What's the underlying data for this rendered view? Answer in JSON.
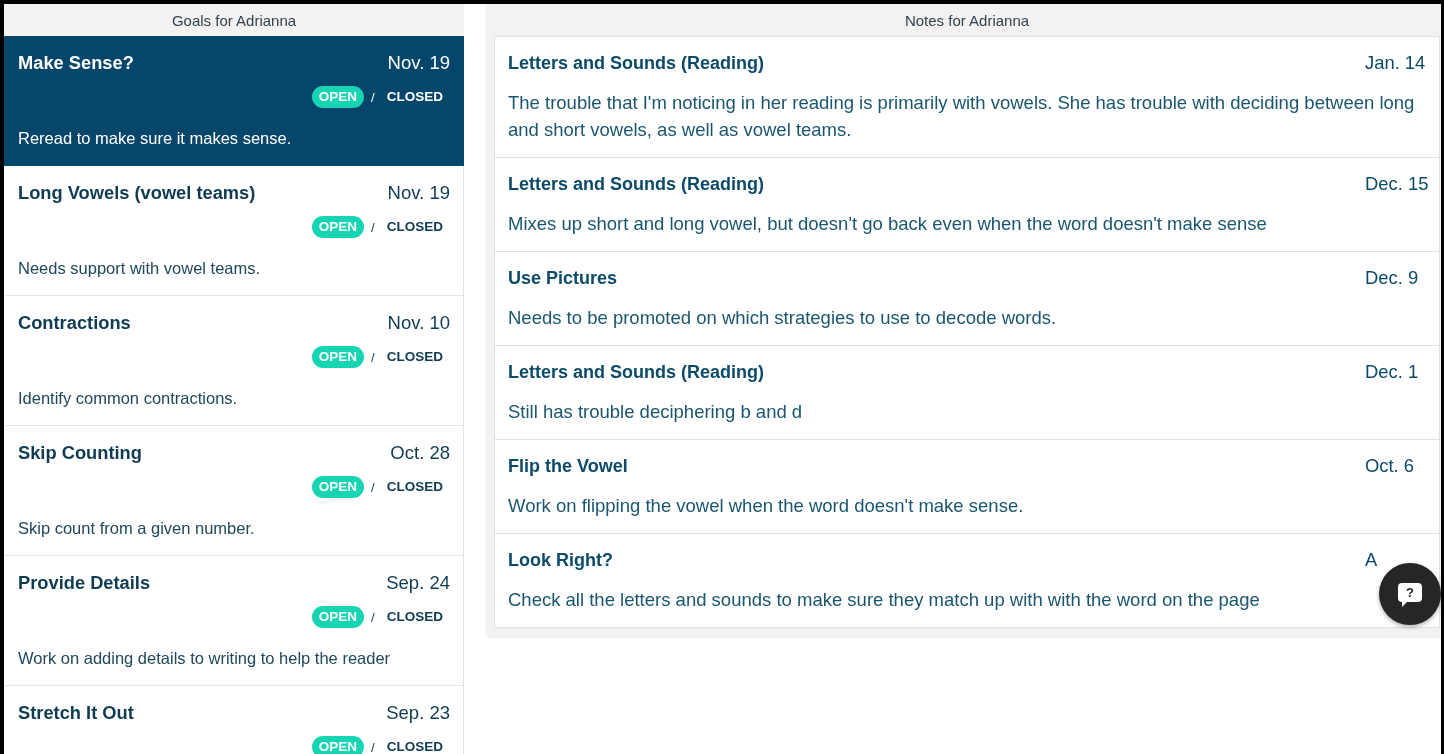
{
  "goals_panel": {
    "title": "Goals for Adrianna",
    "goals": [
      {
        "title": "Make Sense?",
        "date": "Nov. 19",
        "open_label": "OPEN",
        "separator": "/",
        "closed_label": "CLOSED",
        "open": true,
        "description": "Reread to make sure it makes sense.",
        "selected": true
      },
      {
        "title": "Long Vowels (vowel teams)",
        "date": "Nov. 19",
        "open_label": "OPEN",
        "separator": "/",
        "closed_label": "CLOSED",
        "open": true,
        "description": "Needs support with vowel teams.",
        "selected": false
      },
      {
        "title": "Contractions",
        "date": "Nov. 10",
        "open_label": "OPEN",
        "separator": "/",
        "closed_label": "CLOSED",
        "open": true,
        "description": "Identify common contractions.",
        "selected": false
      },
      {
        "title": "Skip Counting",
        "date": "Oct. 28",
        "open_label": "OPEN",
        "separator": "/",
        "closed_label": "CLOSED",
        "open": true,
        "description": "Skip count from a given number.",
        "selected": false
      },
      {
        "title": "Provide Details",
        "date": "Sep. 24",
        "open_label": "OPEN",
        "separator": "/",
        "closed_label": "CLOSED",
        "open": true,
        "description": "Work on adding details to writing to help the reader",
        "selected": false
      },
      {
        "title": "Stretch It Out",
        "date": "Sep. 23",
        "open_label": "OPEN",
        "separator": "/",
        "closed_label": "CLOSED",
        "open": true,
        "selected": false
      }
    ]
  },
  "notes_panel": {
    "title": "Notes for Adrianna",
    "notes": [
      {
        "title": "Letters and Sounds (Reading)",
        "date": "Jan. 14",
        "body": "The trouble that I'm noticing in her reading is primarily with vowels. She has trouble with deciding between long and short vowels, as well as vowel teams."
      },
      {
        "title": "Letters and Sounds (Reading)",
        "date": "Dec. 15",
        "body": "Mixes up short and long vowel, but doesn't go back even when the word doesn't make sense"
      },
      {
        "title": "Use Pictures",
        "date": "Dec. 9",
        "body": "Needs to be promoted on which strategies to use to decode words."
      },
      {
        "title": "Letters and Sounds (Reading)",
        "date": "Dec. 1",
        "body": "Still has trouble deciphering b and d"
      },
      {
        "title": "Flip the Vowel",
        "date": "Oct. 6",
        "body": "Work on flipping the vowel when the word doesn't make sense."
      },
      {
        "title": "Look Right?",
        "date": "A",
        "body": "Check all the letters and sounds to make sure they match up with with the word on the page"
      }
    ]
  },
  "help_button": {
    "label": "?"
  }
}
